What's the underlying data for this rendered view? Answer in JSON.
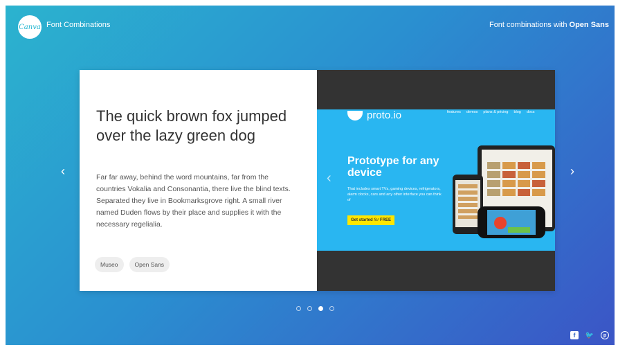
{
  "header": {
    "logo_text": "Canva",
    "title": "Font Combinations",
    "right_prefix": "Font combinations with ",
    "right_font": "Open Sans"
  },
  "slide": {
    "headline": "The quick brown fox jumped over the lazy green dog",
    "body": "Far far away, behind the word mountains, far from the countries Vokalia and Consonantia, there live the blind texts. Separated they live in Bookmarksgrove right. A small river named Duden flows by their place and supplies it with the necessary regelialia.",
    "fonts": [
      "Museo",
      "Open Sans"
    ]
  },
  "preview": {
    "logo": "proto.io",
    "nav": [
      "features",
      "demos",
      "plans & pricing",
      "blog",
      "docs"
    ],
    "title": "Prototype for any device",
    "subtitle": "That includes smart TVs, gaming devices, refrigerators, alarm clocks, cars and any other interface you can think of",
    "cta_main": "Get started ",
    "cta_italic": "for",
    "cta_end": " FREE"
  },
  "carousel": {
    "prev": "‹",
    "next": "›",
    "dot_count": 4,
    "active_index": 2
  },
  "social": {
    "facebook": "f",
    "twitter": "🐦",
    "pinterest": "p"
  },
  "colors": {
    "gradient_start": "#2bb3cf",
    "gradient_end": "#3b55c6",
    "preview_blue": "#29b6f1",
    "cta_yellow": "#ffe600"
  }
}
